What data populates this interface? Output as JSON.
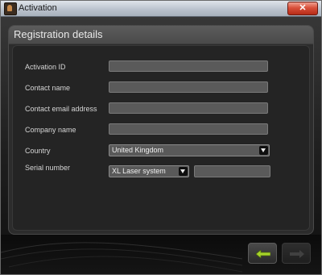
{
  "window": {
    "title": "Activation",
    "close_glyph": "✕"
  },
  "panel": {
    "title": "Registration details"
  },
  "form": {
    "activation_id": {
      "label": "Activation ID",
      "value": ""
    },
    "contact_name": {
      "label": "Contact name",
      "value": ""
    },
    "contact_email": {
      "label": "Contact email address",
      "value": ""
    },
    "company_name": {
      "label": "Company name",
      "value": ""
    },
    "country": {
      "label": "Country",
      "selected": "United Kingdom"
    },
    "serial_number": {
      "label": "Serial number",
      "product_selected": "XL Laser system",
      "value": ""
    }
  },
  "footer": {
    "back_icon": "arrow-left-icon",
    "next_icon": "arrow-right-icon",
    "back_color": "#a5d22a",
    "next_color": "#6a6a6a"
  }
}
